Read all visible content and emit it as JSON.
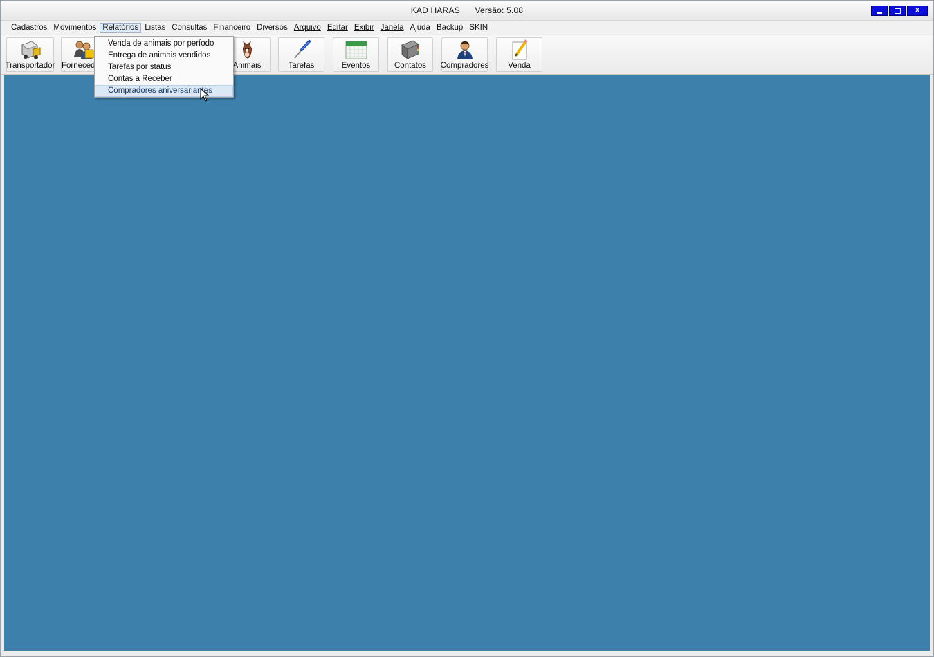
{
  "window": {
    "title_app": "KAD HARAS",
    "title_version": "Versão: 5.08",
    "controls": {
      "minimize": "minimize",
      "maximize": "maximize",
      "close": "X"
    }
  },
  "menubar": {
    "items": [
      {
        "label": "Cadastros"
      },
      {
        "label": "Movimentos"
      },
      {
        "label": "Relatórios",
        "active": true
      },
      {
        "label": "Listas"
      },
      {
        "label": "Consultas"
      },
      {
        "label": "Financeiro"
      },
      {
        "label": "Diversos"
      },
      {
        "label": "Arquivo"
      },
      {
        "label": "Editar"
      },
      {
        "label": "Exibir"
      },
      {
        "label": "Janela"
      },
      {
        "label": "Ajuda"
      },
      {
        "label": "Backup"
      },
      {
        "label": "SKIN"
      }
    ]
  },
  "toolbar": {
    "buttons": [
      {
        "label": "Transportador",
        "icon": "truck-icon"
      },
      {
        "label": "Fornecedo",
        "icon": "supplier-icon"
      },
      {
        "label": "Animais",
        "icon": "horse-icon"
      },
      {
        "label": "Tarefas",
        "icon": "screwdriver-icon"
      },
      {
        "label": "Eventos",
        "icon": "calendar-icon"
      },
      {
        "label": "Contatos",
        "icon": "address-book-icon"
      },
      {
        "label": "Compradores",
        "icon": "buyer-icon"
      },
      {
        "label": "Venda",
        "icon": "pencil-paper-icon"
      }
    ]
  },
  "dropdown": {
    "items": [
      {
        "label": "Venda de animais por período"
      },
      {
        "label": "Entrega de animais vendidos"
      },
      {
        "label": "Tarefas por status"
      },
      {
        "label": "Contas a Receber"
      },
      {
        "label": "Compradores aniversariantes",
        "hover": true
      }
    ]
  },
  "colors": {
    "client_area": "#3d80ab",
    "title_buttons": "#0a10d8",
    "menu_highlight": "#dbe8f6"
  }
}
